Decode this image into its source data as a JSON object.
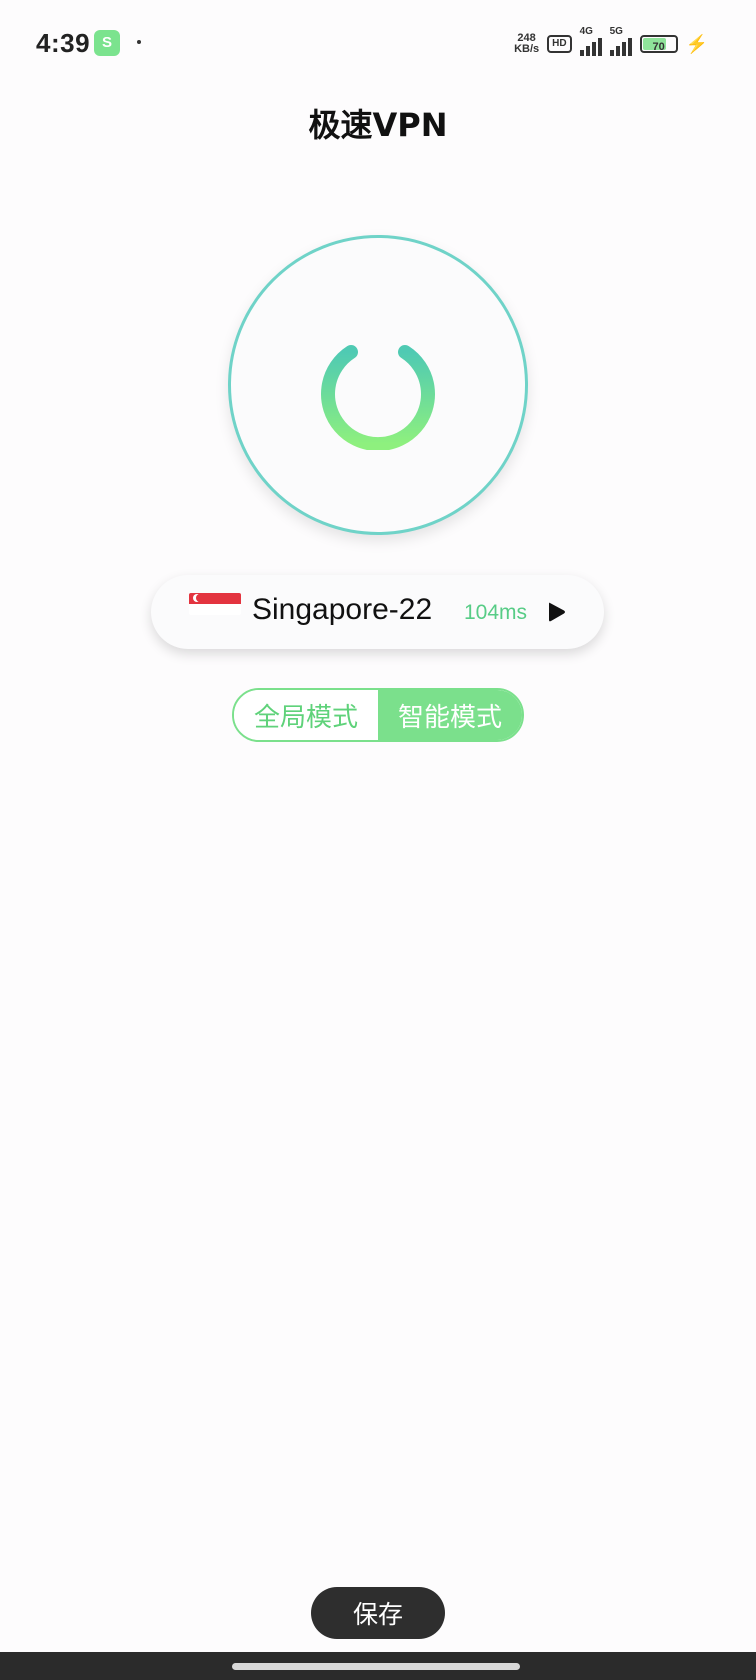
{
  "status_bar": {
    "time": "4:39",
    "app_icon_glyph": "S",
    "net_speed_value": "248",
    "net_speed_unit": "KB/s",
    "hd_label": "HD",
    "sim1_label": "4G",
    "sim2_label": "5G",
    "battery_level": "70",
    "charging_icon": "bolt-icon"
  },
  "header": {
    "title": "极速VPN"
  },
  "power": {
    "icon": "power-icon",
    "ring_color": "#6fd3c8",
    "gradient_top": "#4fcab3",
    "gradient_bottom": "#8ef07e"
  },
  "server": {
    "flag": "singapore-flag-icon",
    "name": "Singapore-22",
    "latency": "104ms",
    "arrow_icon": "play-arrow-icon"
  },
  "mode": {
    "options": [
      "全局模式",
      "智能模式"
    ],
    "selected": "智能模式",
    "accent_color": "#7be08c"
  },
  "footer": {
    "save_label": "保存"
  }
}
